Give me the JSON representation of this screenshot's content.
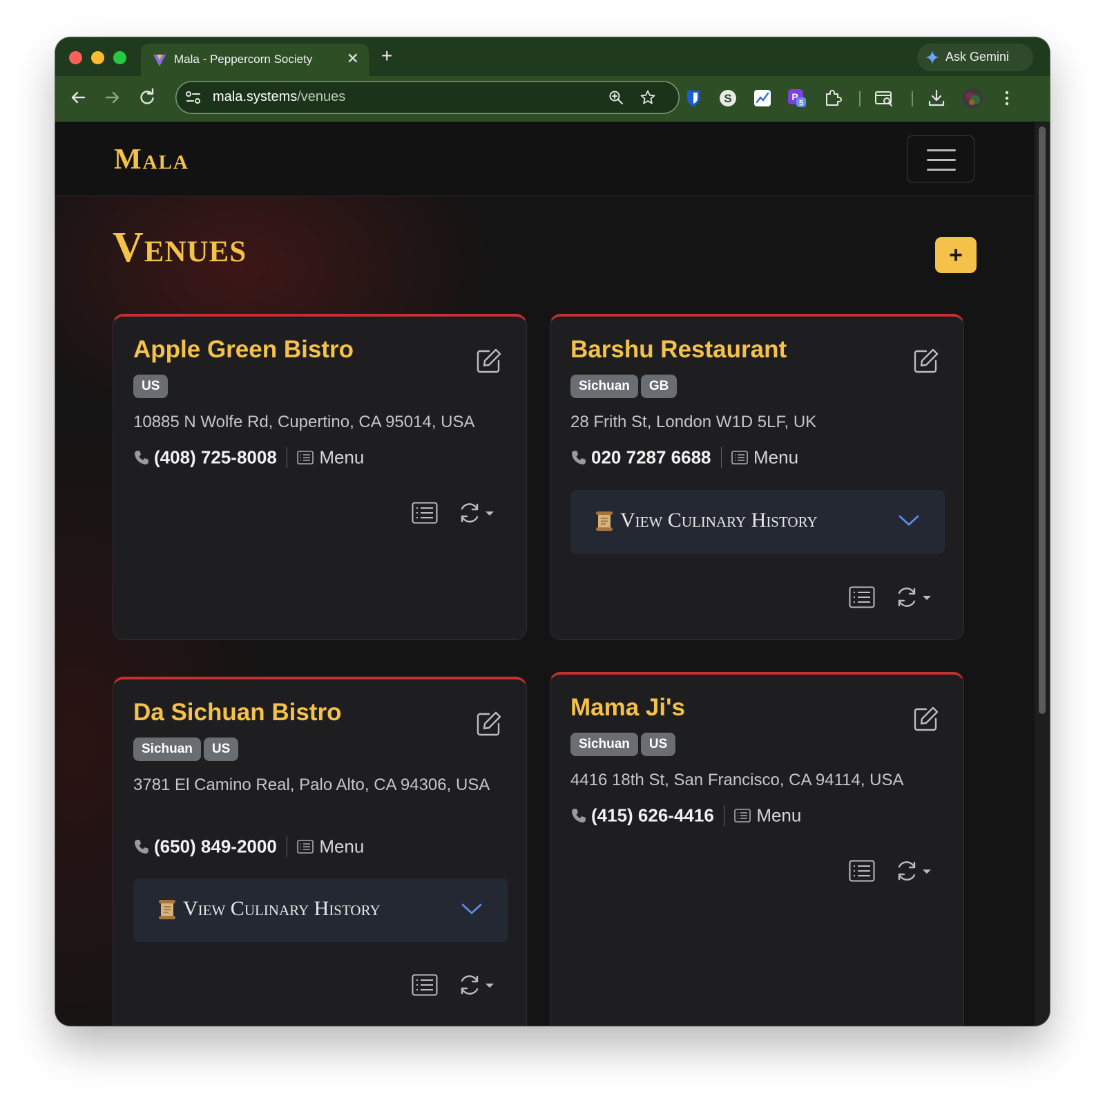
{
  "browser": {
    "tab_title": "Mala - Peppercorn Society",
    "tab_close": "✕",
    "new_tab": "+",
    "ask_gemini": "Ask Gemini",
    "url_host": "mala.systems",
    "url_path": "/venues",
    "extension_badge": "5"
  },
  "app": {
    "brand": "Mala",
    "page_title": "Venues",
    "add_label": "+"
  },
  "venues": [
    {
      "name": "Apple Green Bistro",
      "badges": [
        "US"
      ],
      "address": "10885 N Wolfe Rd, Cupertino, CA 95014, USA",
      "phone": "(408) 725-8008",
      "menu_label": "Menu",
      "history_label": ""
    },
    {
      "name": "Barshu Restaurant",
      "badges": [
        "Sichuan",
        "GB"
      ],
      "address": "28 Frith St, London W1D 5LF, UK",
      "phone": "020 7287 6688",
      "menu_label": "Menu",
      "history_label": "View Culinary History"
    },
    {
      "name": "Da Sichuan Bistro",
      "badges": [
        "Sichuan",
        "US"
      ],
      "address": "3781 El Camino Real, Palo Alto, CA 94306, USA",
      "phone": "(650) 849-2000",
      "menu_label": "Menu",
      "history_label": "View Culinary History"
    },
    {
      "name": "Mama Ji's",
      "badges": [
        "Sichuan",
        "US"
      ],
      "address": "4416 18th St, San Francisco, CA 94114, USA",
      "phone": "(415) 626-4416",
      "menu_label": "Menu",
      "history_label": ""
    }
  ],
  "colors": {
    "accent_gold": "#f4c24a",
    "card_top_border": "#c7302c",
    "browser_frame": "#2e4e26"
  },
  "icons": [
    "edit-icon",
    "phone-icon",
    "menu-icon",
    "scroll-icon",
    "chevron-down-icon",
    "list-icon",
    "sync-icon",
    "caret-down-icon"
  ]
}
